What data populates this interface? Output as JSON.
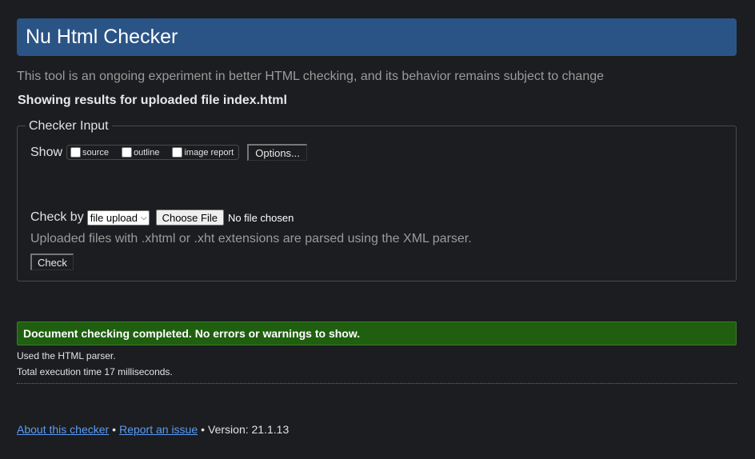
{
  "header": {
    "title": "Nu Html Checker"
  },
  "tagline": "This tool is an ongoing experiment in better HTML checking, and its behavior remains subject to change",
  "showing": "Showing results for uploaded file index.html",
  "checker_input": {
    "legend": "Checker Input",
    "show_label": "Show",
    "show_options": [
      {
        "label": "source",
        "checked": false
      },
      {
        "label": "outline",
        "checked": false
      },
      {
        "label": "image report",
        "checked": false
      }
    ],
    "options_button": "Options...",
    "check_by_label": "Check by",
    "check_by_value": "file upload",
    "choose_file_button": "Choose File",
    "no_file_text": "No file chosen",
    "hint": "Uploaded files with .xhtml or .xht extensions are parsed using the XML parser.",
    "check_button": "Check"
  },
  "result": {
    "success_message": "Document checking completed. No errors or warnings to show.",
    "success_color": "#1f5f0f",
    "parser_line": "Used the HTML parser.",
    "time_line": "Total execution time 17 milliseconds."
  },
  "footer": {
    "about_link": "About this checker",
    "bullet": "•",
    "report_link": "Report an issue",
    "version": "Version: 21.1.13"
  },
  "colors": {
    "accent": "#2b5486",
    "link": "#5a9cf5",
    "background": "#1c1d20"
  }
}
